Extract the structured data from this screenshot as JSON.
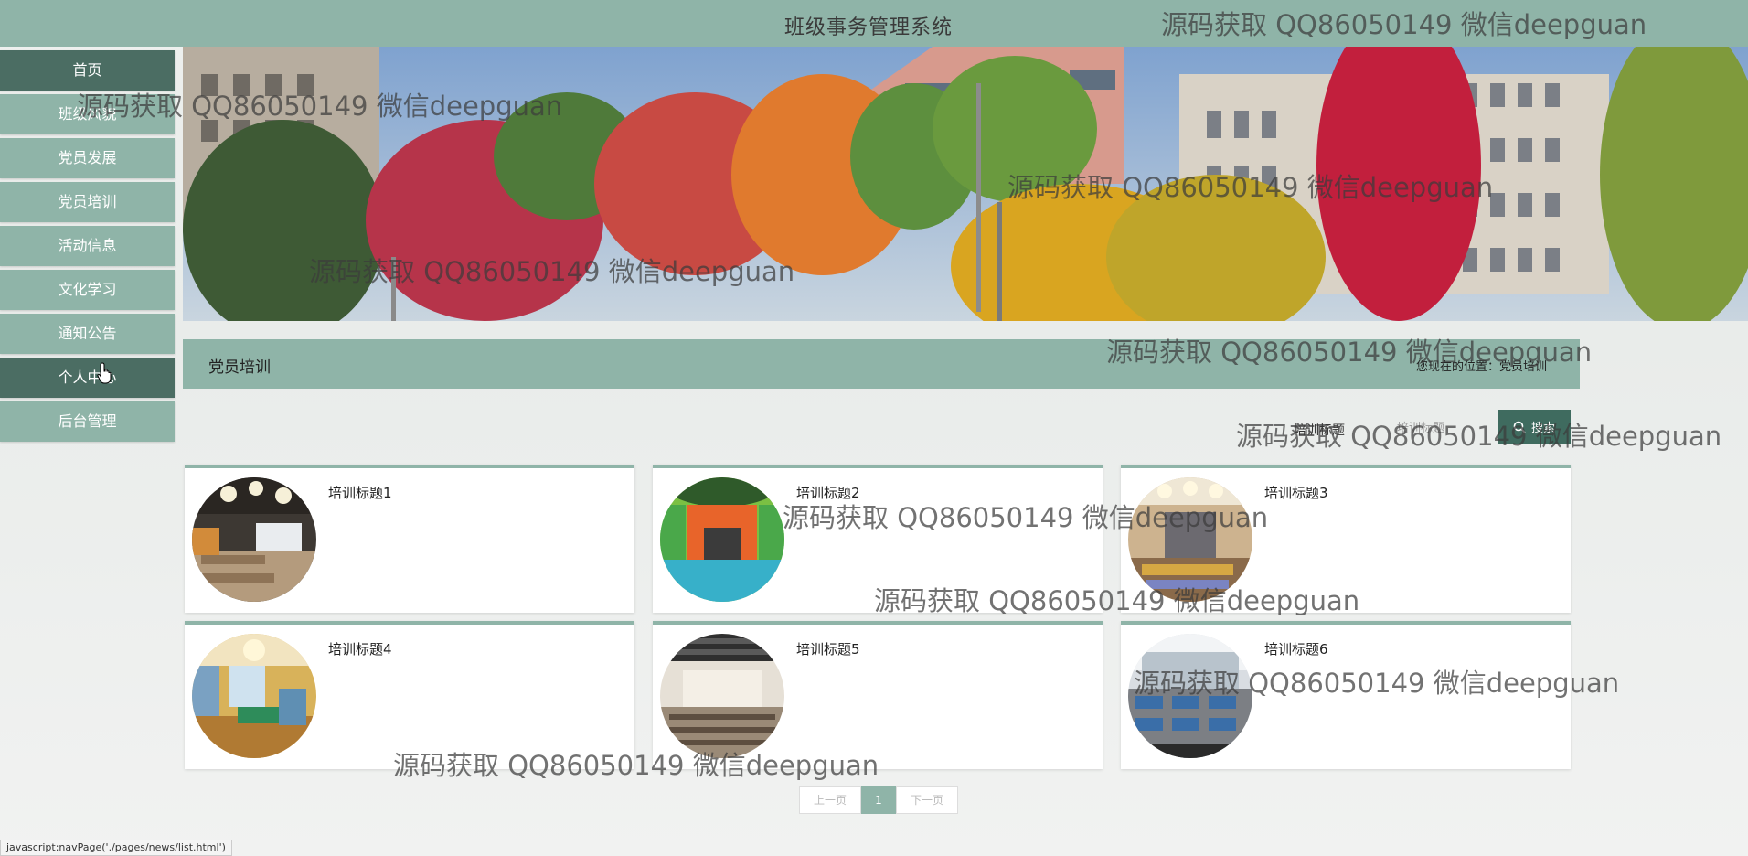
{
  "header": {
    "title": "班级事务管理系统"
  },
  "watermark_text": "源码获取 QQ86050149 微信deepguan",
  "sidebar": {
    "items": [
      {
        "label": "首页"
      },
      {
        "label": "班级风貌"
      },
      {
        "label": "党员发展"
      },
      {
        "label": "党员培训"
      },
      {
        "label": "活动信息"
      },
      {
        "label": "文化学习"
      },
      {
        "label": "通知公告"
      },
      {
        "label": "个人中心"
      },
      {
        "label": "后台管理"
      }
    ]
  },
  "section": {
    "title": "党员培训",
    "breadcrumb": "您现在的位置：党员培训"
  },
  "search": {
    "label": "培训标题",
    "placeholder": "培训标题",
    "button_label": "搜索"
  },
  "cards": [
    {
      "title": "培训标题1"
    },
    {
      "title": "培训标题2"
    },
    {
      "title": "培训标题3"
    },
    {
      "title": "培训标题4"
    },
    {
      "title": "培训标题5"
    },
    {
      "title": "培训标题6"
    }
  ],
  "pagination": {
    "prev": "上一页",
    "current": "1",
    "next": "下一页"
  },
  "status_bar": {
    "text": "javascript:navPage('./pages/news/list.html')"
  },
  "colors": {
    "accent": "#8fb4a8",
    "accent_dark": "#4b6d63",
    "button": "#3f6b5f"
  }
}
